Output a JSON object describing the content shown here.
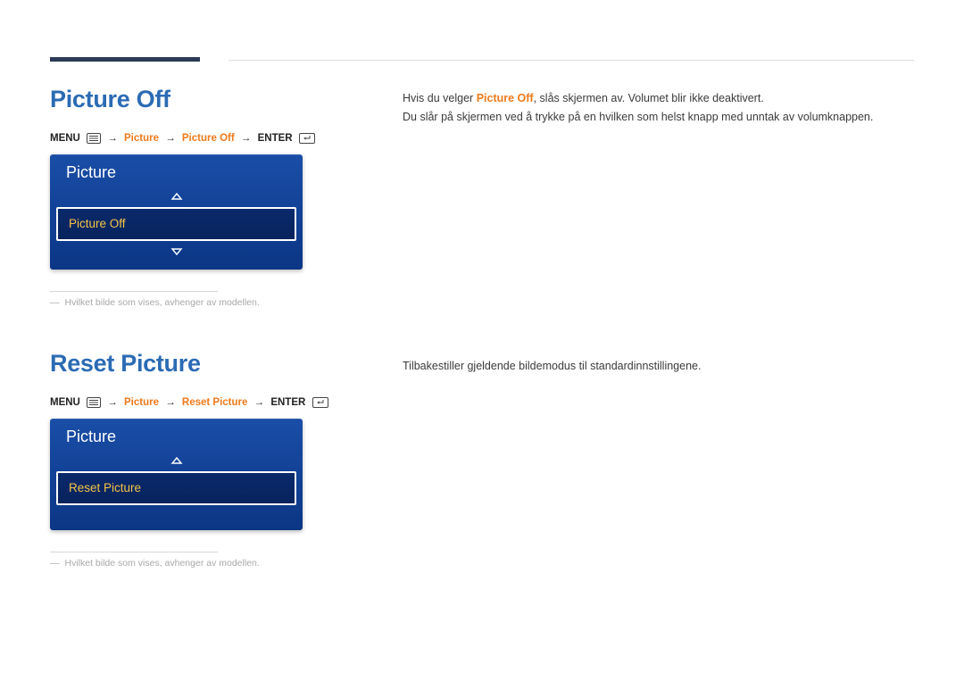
{
  "sections": {
    "pictureOff": {
      "title": "Picture Off",
      "path": {
        "menu": "MENU",
        "seg1": "Picture",
        "seg2": "Picture Off",
        "enter": "ENTER"
      },
      "panel": {
        "header": "Picture",
        "selected": "Picture Off"
      },
      "footnote": "Hvilket bilde som vises, avhenger av modellen.",
      "body": {
        "line1_pre": "Hvis du velger ",
        "line1_em": "Picture Off",
        "line1_post": ", slås skjermen av. Volumet blir ikke deaktivert.",
        "line2": "Du slår på skjermen ved å trykke på en hvilken som helst knapp med unntak av volumknappen."
      }
    },
    "resetPicture": {
      "title": "Reset Picture",
      "path": {
        "menu": "MENU",
        "seg1": "Picture",
        "seg2": "Reset Picture",
        "enter": "ENTER"
      },
      "panel": {
        "header": "Picture",
        "selected": "Reset Picture"
      },
      "footnote": "Hvilket bilde som vises, avhenger av modellen.",
      "body": {
        "line1": "Tilbakestiller gjeldende bildemodus til standardinnstillingene."
      }
    }
  }
}
